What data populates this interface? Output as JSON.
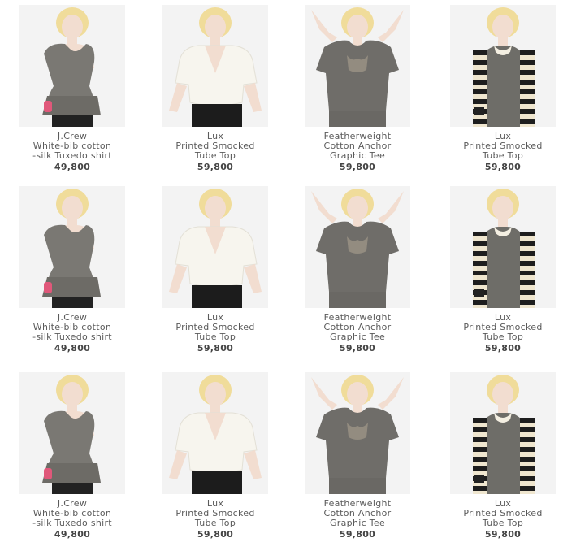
{
  "rows": [
    {
      "items": [
        {
          "brand": "J.Crew",
          "name_line1": "White-bib cotton",
          "name_line2": "-silk Tuxedo shirt",
          "price": "49,800",
          "garment": "gray-peplum-top"
        },
        {
          "brand": "Lux",
          "name_line1": "Printed Smocked",
          "name_line2": "Tube Top",
          "price": "59,800",
          "garment": "white-vneck-top"
        },
        {
          "brand": "Featherweight",
          "name_line1": "Cotton Anchor",
          "name_line2": "Graphic Tee",
          "price": "59,800",
          "garment": "gray-graphic-tee"
        },
        {
          "brand": "Lux",
          "name_line1": "Printed Smocked",
          "name_line2": "Tube Top",
          "price": "59,800",
          "garment": "striped-cardigan-dress"
        }
      ]
    },
    {
      "items": [
        {
          "brand": "J.Crew",
          "name_line1": "White-bib cotton",
          "name_line2": "-silk Tuxedo shirt",
          "price": "49,800",
          "garment": "gray-peplum-top"
        },
        {
          "brand": "Lux",
          "name_line1": "Printed Smocked",
          "name_line2": "Tube Top",
          "price": "59,800",
          "garment": "white-vneck-top"
        },
        {
          "brand": "Featherweight",
          "name_line1": "Cotton Anchor",
          "name_line2": "Graphic Tee",
          "price": "59,800",
          "garment": "gray-graphic-tee"
        },
        {
          "brand": "Lux",
          "name_line1": "Printed Smocked",
          "name_line2": "Tube Top",
          "price": "59,800",
          "garment": "striped-cardigan-dress"
        }
      ]
    },
    {
      "items": [
        {
          "brand": "J.Crew",
          "name_line1": "White-bib cotton",
          "name_line2": "-silk Tuxedo shirt",
          "price": "49,800",
          "garment": "gray-peplum-top"
        },
        {
          "brand": "Lux",
          "name_line1": "Printed Smocked",
          "name_line2": "Tube Top",
          "price": "59,800",
          "garment": "white-vneck-top"
        },
        {
          "brand": "Featherweight",
          "name_line1": "Cotton Anchor",
          "name_line2": "Graphic Tee",
          "price": "59,800",
          "garment": "gray-graphic-tee"
        },
        {
          "brand": "Lux",
          "name_line1": "Printed Smocked",
          "name_line2": "Tube Top",
          "price": "59,800",
          "garment": "striped-cardigan-dress"
        }
      ]
    }
  ],
  "colors": {
    "photo_bg": "#f1f1f1",
    "caption_text": "#5a5a5a",
    "price_text": "#444444"
  }
}
